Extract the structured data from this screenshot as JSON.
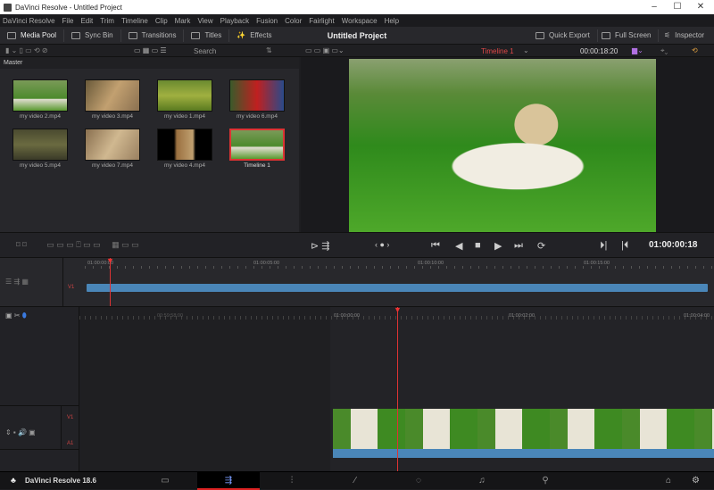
{
  "window": {
    "title": "DaVinci Resolve - Untitled Project",
    "minimize": "–",
    "maximize": "☐",
    "close": "✕"
  },
  "menu": [
    "DaVinci Resolve",
    "File",
    "Edit",
    "Trim",
    "Timeline",
    "Clip",
    "Mark",
    "View",
    "Playback",
    "Fusion",
    "Color",
    "Fairlight",
    "Workspace",
    "Help"
  ],
  "toolbar": {
    "media_pool": "Media Pool",
    "sync_bin": "Sync Bin",
    "transitions": "Transitions",
    "titles": "Titles",
    "effects": "Effects",
    "project_title": "Untitled Project",
    "quick_export": "Quick Export",
    "full_screen": "Full Screen",
    "inspector": "Inspector"
  },
  "subbar": {
    "search_placeholder": "Search",
    "timeline_name": "Timeline 1",
    "source_timecode": "00:00:18:20"
  },
  "pool": {
    "bin": "Master",
    "clips": [
      "my video 2.mp4",
      "my video 3.mp4",
      "my video 1.mp4",
      "my video 6.mp4",
      "my video 5.mp4",
      "my video 7.mp4",
      "my video 4.mp4",
      "Timeline 1"
    ]
  },
  "viewer": {
    "timecode": "01:00:00:18"
  },
  "upper_ruler": [
    "01:00:00:00",
    "01:00:05:00",
    "01:00:10:00",
    "01:00:15:00"
  ],
  "lower_ruler": [
    "00:59:58:00",
    "01:00:00:00",
    "01:00:02:00",
    "01:00:04:00"
  ],
  "tracks": {
    "v1": "V1",
    "a1": "A1"
  },
  "footer": {
    "app": "DaVinci Resolve 18.6"
  },
  "colors": {
    "accent": "#d33333",
    "clip_blue": "#4a86b8"
  }
}
